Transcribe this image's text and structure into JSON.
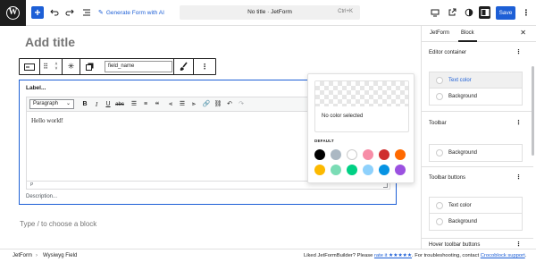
{
  "topbar": {
    "add_label": "+",
    "ai_label": "Generate Form with AI",
    "doc_title": "No title · JetForm",
    "shortcut": "Ctrl+K",
    "save_label": "Save"
  },
  "editor": {
    "title_placeholder": "Add title",
    "field_name": "field_name",
    "block_label": "Label...",
    "format_select": "Paragraph",
    "content": "Hello world!",
    "status_path": "P",
    "description": "Description...",
    "appender_placeholder": "Type / to choose a block"
  },
  "color_popover": {
    "no_color_label": "No color selected",
    "default_label": "DEFAULT",
    "swatches": [
      "#000000",
      "#abb8c3",
      "#ffffff",
      "#f78da7",
      "#cf2e2e",
      "#ff6900",
      "#fcb900",
      "#7bdcb5",
      "#00d084",
      "#8ed1fc",
      "#0693e3",
      "#9b51e0"
    ]
  },
  "sidebar": {
    "tabs": [
      "JetForm",
      "Block"
    ],
    "active_tab": "Block",
    "sections": [
      {
        "title": "Editor container",
        "options": [
          "Text color",
          "Background"
        ]
      },
      {
        "title": "Toolbar",
        "options": [
          "Background"
        ]
      },
      {
        "title": "Toolbar buttons",
        "options": [
          "Text color",
          "Background"
        ]
      },
      {
        "title": "Hover toolbar buttons",
        "options": []
      }
    ]
  },
  "footer": {
    "breadcrumbs": [
      "JetForm",
      "Wysiwyg Field"
    ],
    "note_prefix": "Liked JetFormBuilder? Please ",
    "note_rate": "rate it ★★★★★",
    "note_middle": ". For troubleshooting, contact ",
    "note_support": "Crocoblock support",
    "note_suffix": "."
  },
  "colors": {
    "accent": "#1d5fd6",
    "dark": "#1e1e1e"
  }
}
